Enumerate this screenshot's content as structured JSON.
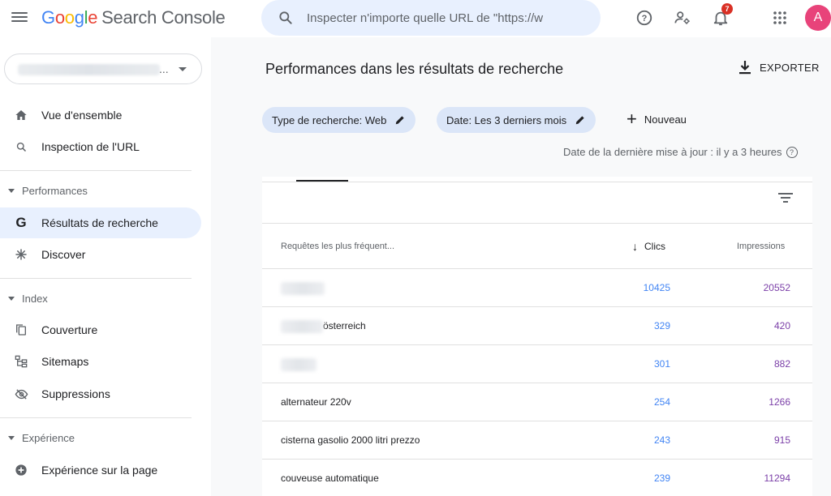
{
  "app": {
    "logo_google": [
      "G",
      "o",
      "o",
      "g",
      "l",
      "e"
    ],
    "logo_product": "Search Console",
    "search_placeholder": "Inspecter n'importe quelle URL de \"https://w",
    "notifications_count": "7",
    "avatar_letter": "A"
  },
  "sidebar": {
    "property_suffix": "...",
    "items": [
      {
        "label": "Vue d'ensemble",
        "icon": "home-icon"
      },
      {
        "label": "Inspection de l'URL",
        "icon": "search-icon"
      },
      {
        "label": "Résultats de recherche",
        "icon": "google-g-icon",
        "active": true
      },
      {
        "label": "Discover",
        "icon": "asterisk-icon"
      },
      {
        "label": "Couverture",
        "icon": "copy-icon"
      },
      {
        "label": "Sitemaps",
        "icon": "sitemap-icon"
      },
      {
        "label": "Suppressions",
        "icon": "eye-off-icon"
      },
      {
        "label": "Expérience sur la page",
        "icon": "plus-circle-icon"
      }
    ],
    "sections": {
      "performances": "Performances",
      "index": "Index",
      "experience": "Expérience"
    }
  },
  "main": {
    "title": "Performances dans les résultats de recherche",
    "export_label": "EXPORTER",
    "chips": [
      {
        "label": "Type de recherche: Web"
      },
      {
        "label": "Date: Les 3 derniers mois"
      }
    ],
    "new_label": "Nouveau",
    "last_update": "Date de la dernière mise à jour : il y a 3 heures"
  },
  "table": {
    "headers": {
      "query": "Requêtes les plus fréquent...",
      "clicks": "Clics",
      "impressions": "Impressions"
    },
    "rows": [
      {
        "query": "",
        "query_suffix": "",
        "clicks": "10425",
        "impressions": "20552"
      },
      {
        "query": "",
        "query_suffix": "österreich",
        "clicks": "329",
        "impressions": "420"
      },
      {
        "query": "",
        "query_suffix": "",
        "clicks": "301",
        "impressions": "882"
      },
      {
        "query": "alternateur 220v",
        "query_suffix": "",
        "clicks": "254",
        "impressions": "1266"
      },
      {
        "query": "cisterna gasolio 2000 litri prezzo",
        "query_suffix": "",
        "clicks": "243",
        "impressions": "915"
      },
      {
        "query": "couveuse automatique",
        "query_suffix": "",
        "clicks": "239",
        "impressions": "11294"
      }
    ]
  },
  "colors": {
    "accent_blue": "#4285f4",
    "impressions_purple": "#7b3fa8",
    "active_nav_bg": "#e8f0fe",
    "avatar_bg": "#e8437a",
    "badge_red": "#d93025"
  }
}
